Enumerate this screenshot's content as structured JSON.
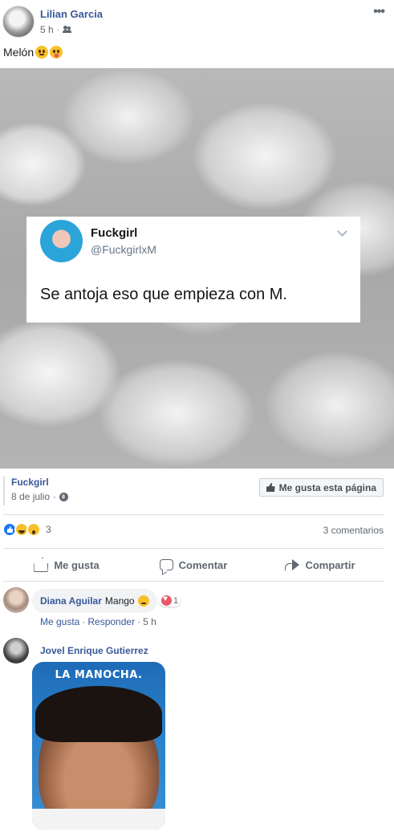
{
  "post": {
    "author": "Lilian Garcia",
    "time": "5 h",
    "dot": "·",
    "more_label": "•••",
    "status_text": "Melón"
  },
  "tweet": {
    "name": "Fuckgirl",
    "handle": "@FuckgirlxM",
    "text": "Se antoja eso que empieza con M."
  },
  "shared_page": {
    "name": "Fuckgirl",
    "date": "8 de julio",
    "dot": "·",
    "like_page_label": "Me gusta esta página"
  },
  "stats": {
    "reaction_count": "3",
    "comments_count": "3 comentarios"
  },
  "actions": {
    "like": "Me gusta",
    "comment": "Comentar",
    "share": "Compartir"
  },
  "comments": [
    {
      "author": "Diana Aguilar",
      "text": "Mango",
      "love_count": "1",
      "like_link": "Me gusta",
      "reply_link": "Responder",
      "dot": "·",
      "time": "5 h"
    },
    {
      "author": "Jovel Enrique Gutierrez",
      "sticker_caption": "LA MANOCHA."
    }
  ],
  "colors": {
    "link": "#385898",
    "secondary_text": "#606770",
    "like_blue": "#1877f2",
    "love_red": "#e9596a"
  }
}
